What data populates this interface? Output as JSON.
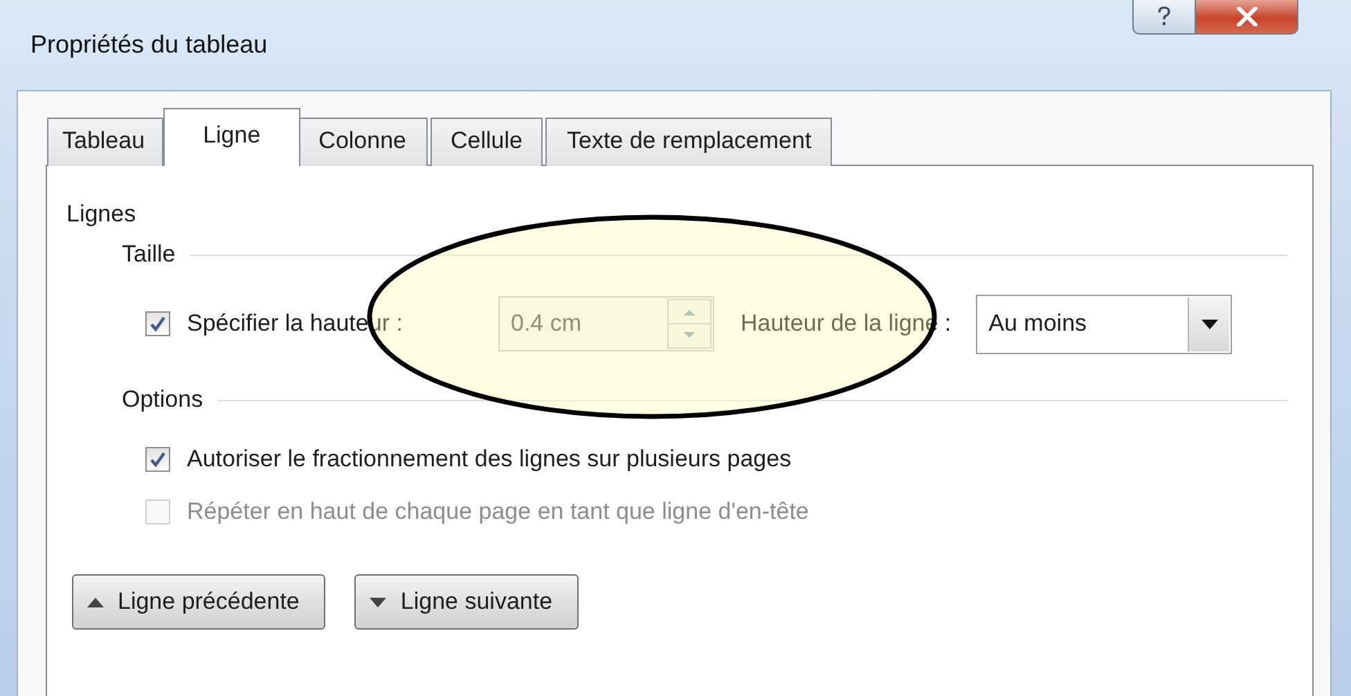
{
  "window": {
    "title": "Propriétés du tableau"
  },
  "title_buttons": [
    {
      "kind": "help"
    },
    {
      "kind": "close"
    }
  ],
  "tabs": [
    {
      "label": "Tableau",
      "selected": false
    },
    {
      "label": "Ligne",
      "selected": true
    },
    {
      "label": "Colonne",
      "selected": false
    },
    {
      "label": "Cellule",
      "selected": false
    },
    {
      "label": "Texte de remplacement",
      "selected": false
    }
  ],
  "section_title": "Lignes",
  "groups": [
    {
      "title": "Taille",
      "rows": [
        {
          "kind": "size",
          "label": "Spécifier la hauteur :",
          "checked": true,
          "disabled": false,
          "spin_value": "0.4 cm",
          "combo_label": "Hauteur de la ligne :",
          "combo_value": "Au moins"
        }
      ]
    },
    {
      "title": "Options",
      "rows": [
        {
          "kind": "check",
          "label": "Autoriser le fractionnement des lignes sur plusieurs pages",
          "checked": true,
          "disabled": false
        },
        {
          "kind": "check",
          "label": "Répéter en haut de chaque page en tant que ligne d'en-tête",
          "checked": false,
          "disabled": true
        }
      ]
    }
  ],
  "buttons": [
    {
      "kind": "up",
      "label": "Ligne précédente"
    },
    {
      "kind": "down",
      "label": "Ligne suivante"
    }
  ]
}
